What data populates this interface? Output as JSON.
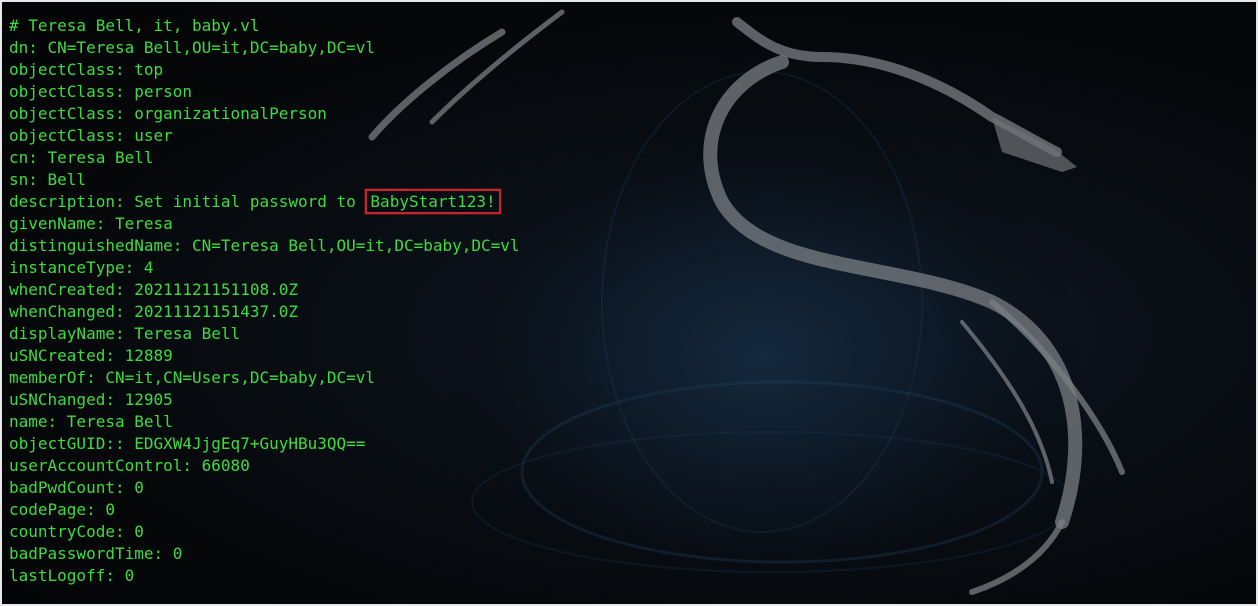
{
  "terminal": {
    "lines": [
      "# Teresa Bell, it, baby.vl",
      "dn: CN=Teresa Bell,OU=it,DC=baby,DC=vl",
      "objectClass: top",
      "objectClass: person",
      "objectClass: organizationalPerson",
      "objectClass: user",
      "cn: Teresa Bell",
      "sn: Bell",
      "description: Set initial password to ",
      "givenName: Teresa",
      "distinguishedName: CN=Teresa Bell,OU=it,DC=baby,DC=vl",
      "instanceType: 4",
      "whenCreated: 20211121151108.0Z",
      "whenChanged: 20211121151437.0Z",
      "displayName: Teresa Bell",
      "uSNCreated: 12889",
      "memberOf: CN=it,CN=Users,DC=baby,DC=vl",
      "uSNChanged: 12905",
      "name: Teresa Bell",
      "objectGUID:: EDGXW4JjgEq7+GuyHBu3QQ==",
      "userAccountControl: 66080",
      "badPwdCount: 0",
      "codePage: 0",
      "countryCode: 0",
      "badPasswordTime: 0",
      "lastLogoff: 0"
    ],
    "highlight": {
      "text": "BabyStart123!",
      "border_color": "#c4262e"
    },
    "text_color": "#3ddc3d",
    "background_color": "#050709"
  },
  "background_art": {
    "icon": "kali-dragon-logo"
  }
}
